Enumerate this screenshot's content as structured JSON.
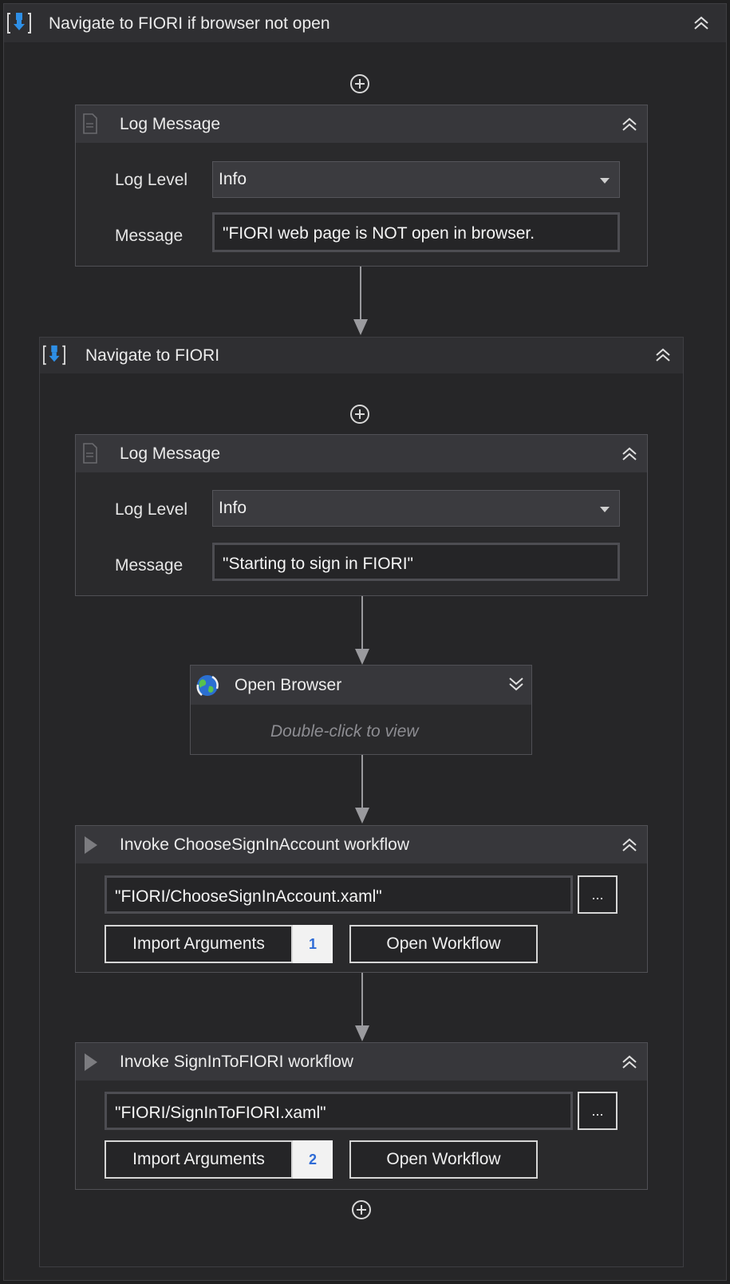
{
  "outer_sequence": {
    "title": "Navigate to FIORI if browser not open"
  },
  "log_message_1": {
    "title": "Log Message",
    "log_level_label": "Log Level",
    "log_level_value": "Info",
    "message_label": "Message",
    "message_value": "\"FIORI web page is NOT open in  browser."
  },
  "inner_sequence": {
    "title": "Navigate to FIORI"
  },
  "log_message_2": {
    "title": "Log Message",
    "log_level_label": "Log Level",
    "log_level_value": "Info",
    "message_label": "Message",
    "message_value": "\"Starting to sign in FIORI\""
  },
  "open_browser": {
    "title": "Open Browser",
    "hint": "Double-click to view"
  },
  "invoke_1": {
    "title": "Invoke ChooseSignInAccount workflow",
    "path": "\"FIORI/ChooseSignInAccount.xaml\"",
    "browse_label": "...",
    "import_label": "Import Arguments",
    "import_count": "1",
    "open_label": "Open Workflow"
  },
  "invoke_2": {
    "title": "Invoke SignInToFIORI workflow",
    "path": "\"FIORI/SignInToFIORI.xaml\"",
    "browse_label": "...",
    "import_label": "Import Arguments",
    "import_count": "2",
    "open_label": "Open Workflow"
  },
  "icons": {
    "sequence": "sequence-icon",
    "collapse": "double-chevron-up-icon",
    "expand": "double-chevron-down-icon",
    "add": "add-circle-icon",
    "log": "document-icon",
    "invoke": "play-icon",
    "browser": "globe-icon"
  },
  "colors": {
    "background": "#1f1f20",
    "header": "#2f2f32",
    "accent_blue": "#2e8fe6",
    "badge_text": "#2e6bd6"
  }
}
